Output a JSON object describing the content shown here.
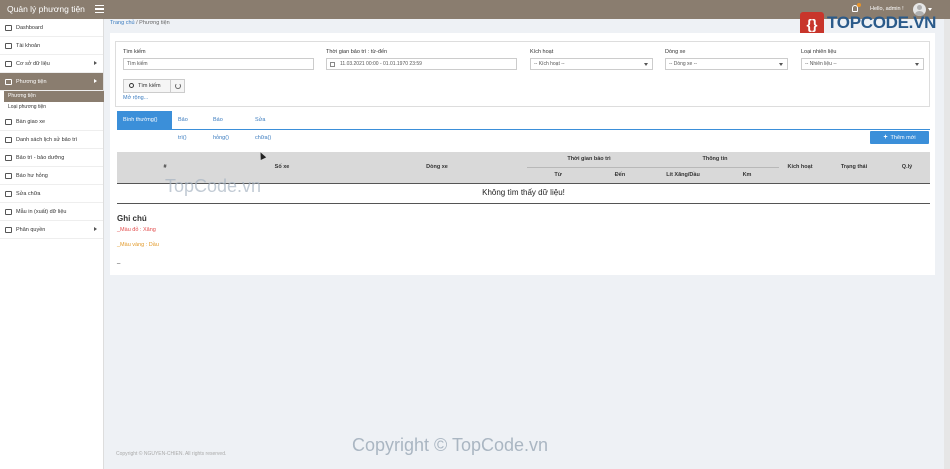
{
  "app": {
    "title": "Quản lý phương tiện"
  },
  "header": {
    "greeting": "Hello, admin !"
  },
  "sidebar": {
    "items": [
      {
        "label": "Dashboard",
        "icon": "monitor-icon"
      },
      {
        "label": "Tài khoản",
        "icon": "users-icon"
      },
      {
        "label": "Cơ sở dữ liệu",
        "icon": "grid-icon",
        "has_arrow": true
      },
      {
        "label": "Phương tiện",
        "icon": "truck-icon",
        "has_arrow": true,
        "active": true
      },
      {
        "label": "Bàn giao xe",
        "icon": "car-icon"
      },
      {
        "label": "Danh sách lịch sử bảo trì",
        "icon": "history-icon"
      },
      {
        "label": "Bảo trì - bảo dưỡng",
        "icon": "garage-icon"
      },
      {
        "label": "Báo hư hỏng",
        "icon": "report-icon"
      },
      {
        "label": "Sửa chữa",
        "icon": "wrench-icon"
      },
      {
        "label": "Mẫu in (xuất) dữ liệu",
        "icon": "print-icon"
      },
      {
        "label": "Phân quyền",
        "icon": "sitemap-icon",
        "has_arrow": true
      }
    ],
    "sub_items": [
      {
        "label": "Phương tiện",
        "current": true
      },
      {
        "label": "Loại phương tiện"
      }
    ]
  },
  "breadcrumb": {
    "home": "Trang chủ",
    "separator": "/",
    "current": "Phương tiện"
  },
  "watermark": {
    "brand": "TOPCODE.VN",
    "center": "TopCode.vn",
    "copyright": "Copyright © TopCode.vn"
  },
  "filters": {
    "search": {
      "label": "Tìm kiếm",
      "placeholder": "Tìm kiếm"
    },
    "date_range": {
      "label": "Thời gian bảo trì : từ-đến",
      "value": "11.03.2021 00:00 - 01.01.1970 23:59"
    },
    "active": {
      "label": "Kích hoạt",
      "value": "-- Kích hoạt --"
    },
    "vehicle_line": {
      "label": "Dòng xe",
      "value": "-- Dòng xe --"
    },
    "fuel_type": {
      "label": "Loại nhiên liệu",
      "value": "-- Nhiên liệu --"
    },
    "search_button": "Tìm kiếm",
    "expand_link": "Mở rộng..."
  },
  "tabs": [
    {
      "label": "Bình thường()",
      "active": true
    },
    {
      "label": "Bảo trì()"
    },
    {
      "label": "Báo hỏng()"
    },
    {
      "label": "Sửa chữa()"
    }
  ],
  "add_button": "Thêm mới",
  "table": {
    "columns": {
      "index": "#",
      "plate": "Số xe",
      "vehicle_line": "Dòng xe",
      "maintenance_time": "Thời gian bảo trì",
      "from": "Từ",
      "to": "Đến",
      "info": "Thông tin",
      "fuel_liters": "Lít Xăng/Dầu",
      "km": "Km",
      "active": "Kích hoạt",
      "status": "Trạng thái",
      "manage": "Q.lý"
    },
    "empty_message": "Không tìm thấy dữ liệu!"
  },
  "notes": {
    "title": "Ghi chú",
    "red": "_Màu đỏ : Xăng",
    "orange": "_Màu vàng : Dầu",
    "dash": "_"
  },
  "colors": {
    "topbar": "#8a7d6f",
    "accent": "#3b8fd9",
    "red": "#e24a4a",
    "orange": "#e29a2a"
  },
  "footer": {
    "text": "Copyright © NGUYEN-CHIEN. All rights reserved."
  }
}
